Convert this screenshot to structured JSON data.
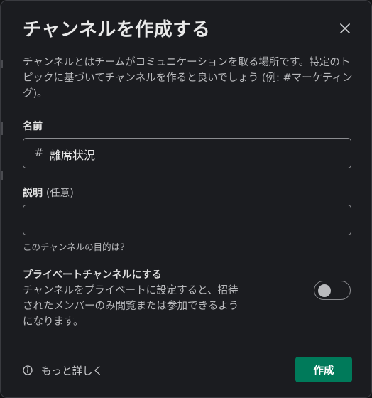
{
  "dialog": {
    "title": "チャンネルを作成する",
    "description": "チャンネルとはチームがコミュニケーションを取る場所です。特定のトピックに基づいてチャンネルを作ると良いでしょう (例: #マーケティング)。",
    "close_icon": "close-icon"
  },
  "name_field": {
    "label": "名前",
    "prefix": "#",
    "value": "離席状況"
  },
  "purpose_field": {
    "label": "説明",
    "optional_label": "(任意)",
    "value": "",
    "hint": "このチャンネルの目的は？"
  },
  "private_setting": {
    "title": "プライベートチャンネルにする",
    "description": "チャンネルをプライベートに設定すると、招待されたメンバーのみ閲覧または参加できるようになります。",
    "enabled": false
  },
  "footer": {
    "learn_more_icon": "info-icon",
    "learn_more_label": "もっと詳しく",
    "create_button_label": "作成",
    "create_button_color": "#007a5a"
  }
}
